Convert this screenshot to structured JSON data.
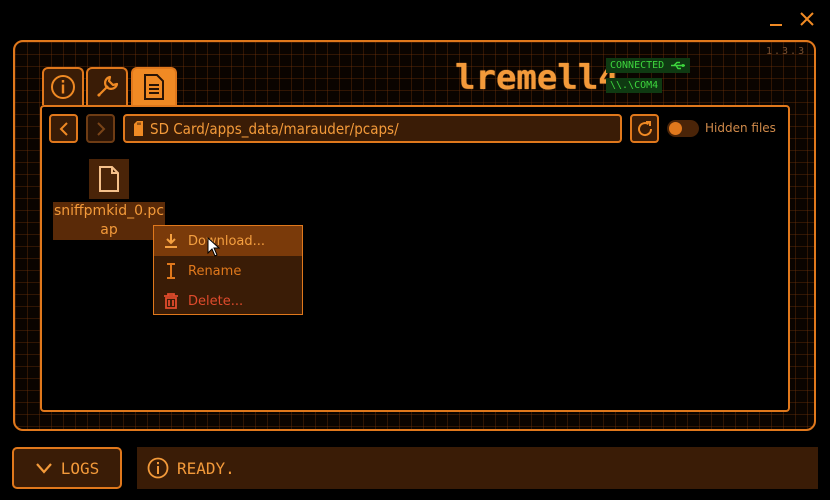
{
  "app": {
    "logo": "lremell4",
    "version": "1.3.3",
    "connection_status": "CONNECTED",
    "port": "\\\\.\\COM4"
  },
  "tabs": [
    {
      "name": "info",
      "icon": "info-icon"
    },
    {
      "name": "tools",
      "icon": "wrench-icon"
    },
    {
      "name": "files",
      "icon": "document-icon",
      "active": true
    }
  ],
  "browser": {
    "path": "SD Card/apps_data/marauder/pcaps/",
    "hidden_files_label": "Hidden files",
    "hidden_files_on": false
  },
  "files": [
    {
      "name": "sniffpmkid_0.pcap",
      "icon": "file-icon"
    }
  ],
  "context_menu": {
    "items": [
      {
        "label": "Download...",
        "icon": "download-icon"
      },
      {
        "label": "Rename",
        "icon": "text-cursor-icon"
      },
      {
        "label": "Delete...",
        "icon": "trash-icon"
      }
    ]
  },
  "footer": {
    "logs_label": "LOGS",
    "status_text": "READY."
  },
  "colors": {
    "accent": "#e0781c",
    "accent_light": "#f39a3a",
    "panel_dark": "#3a1c06",
    "connected_green": "#3dd63d",
    "delete_red": "#e04b2c"
  }
}
